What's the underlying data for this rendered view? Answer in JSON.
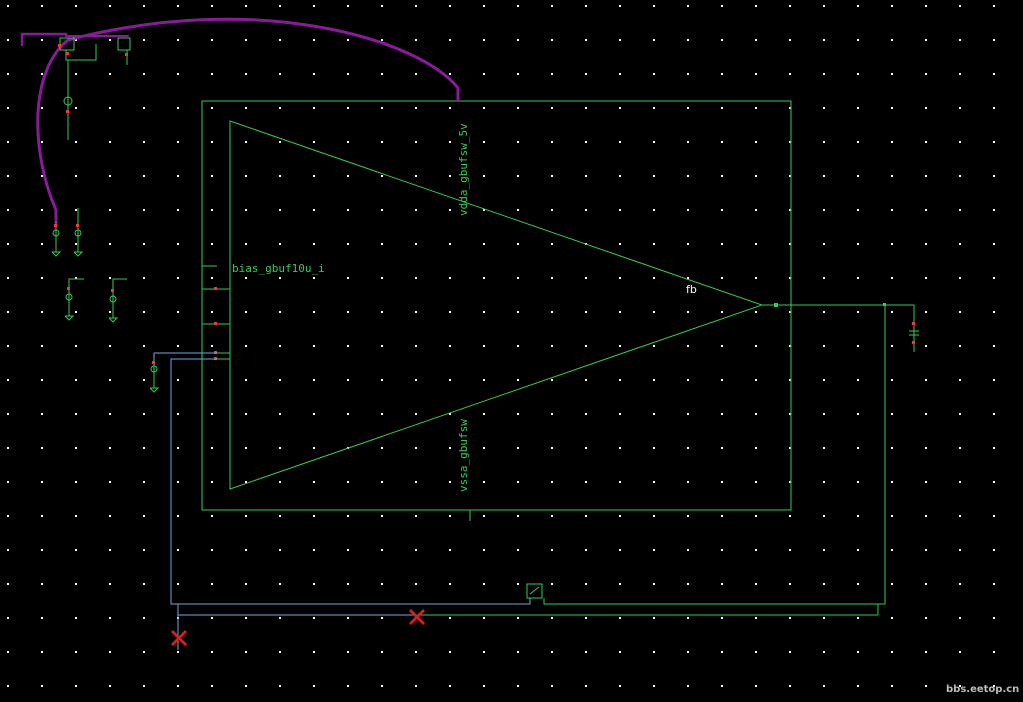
{
  "colors": {
    "background": "#000000",
    "grid_dot": "#ffffff",
    "device": "#33cc55",
    "wire": "#6fa8dc",
    "highlight_net": "#8b1a9b",
    "pin": "#ff3333",
    "error_marker": "#d62020"
  },
  "labels": {
    "vdda_pin": "vdda_gbufsw_5v",
    "vssa_pin": "vssa_gbufsw",
    "bias_pin": "bias_gbuf10u_i",
    "fb_net": "fb"
  },
  "watermark": "bbs.eetop.cn"
}
